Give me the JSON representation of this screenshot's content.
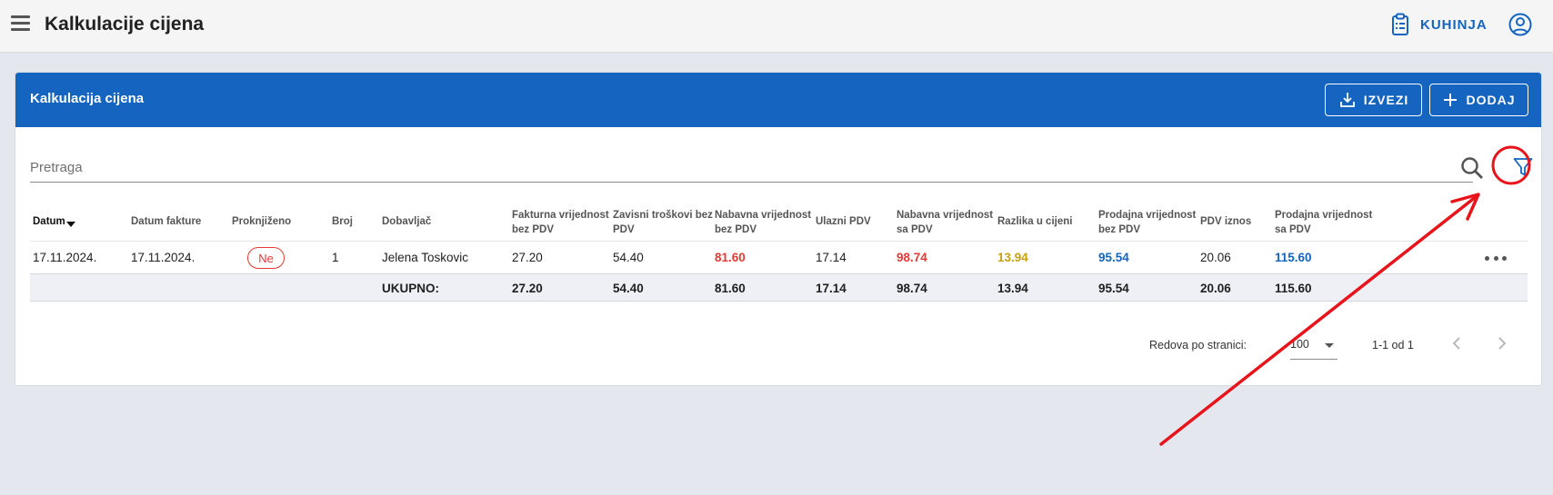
{
  "app": {
    "title": "Kalkulacije cijena",
    "kitchen_label": "KUHINJA"
  },
  "card": {
    "title": "Kalkulacija cijena",
    "export_label": "IZVEZI",
    "add_label": "DODAJ"
  },
  "search": {
    "placeholder": "Pretraga"
  },
  "table": {
    "headers": {
      "datum": "Datum",
      "datum_fakture": "Datum fakture",
      "proknjizeno": "Proknjiženo",
      "broj": "Broj",
      "dobavljac": "Dobavljač",
      "fakturna_1": "Fakturna vrijednost",
      "fakturna_2": "bez PDV",
      "zavisni_1": "Zavisni troškovi bez",
      "zavisni_2": "PDV",
      "nabavna_bez_1": "Nabavna vrijednost",
      "nabavna_bez_2": "bez PDV",
      "ulazni_pdv": "Ulazni PDV",
      "nabavna_sa_1": "Nabavna vrijednost",
      "nabavna_sa_2": "sa PDV",
      "razlika": "Razlika u cijeni",
      "prodajna_bez_1": "Prodajna vrijednost",
      "prodajna_bez_2": "bez PDV",
      "pdv_iznos": "PDV iznos",
      "prodajna_sa_1": "Prodajna vrijednost",
      "prodajna_sa_2": "sa PDV"
    },
    "rows": [
      {
        "datum": "17.11.2024.",
        "datum_fakture": "17.11.2024.",
        "proknjizeno": "Ne",
        "broj": "1",
        "dobavljac": "Jelena Toskovic",
        "fakturna": "27.20",
        "zavisni": "54.40",
        "nabavna_bez": "81.60",
        "ulazni_pdv": "17.14",
        "nabavna_sa": "98.74",
        "razlika": "13.94",
        "prodajna_bez": "95.54",
        "pdv_iznos": "20.06",
        "prodajna_sa": "115.60"
      }
    ],
    "totals": {
      "label": "UKUPNO:",
      "fakturna": "27.20",
      "zavisni": "54.40",
      "nabavna_bez": "81.60",
      "ulazni_pdv": "17.14",
      "nabavna_sa": "98.74",
      "razlika": "13.94",
      "prodajna_bez": "95.54",
      "pdv_iznos": "20.06",
      "prodajna_sa": "115.60"
    }
  },
  "pagination": {
    "rows_per_page_label": "Redova po stranici:",
    "rows_per_page": "100",
    "range": "1-1 od 1"
  },
  "colors": {
    "primary": "#1565c0",
    "negative": "#e53935",
    "difference": "#c9a10e",
    "annotation": "#e8141b"
  },
  "icons": [
    "menu-icon",
    "clipboard-icon",
    "account-circle-icon",
    "download-icon",
    "plus-icon",
    "search-icon",
    "filter-icon",
    "more-horiz-icon",
    "chevron-left-icon",
    "chevron-right-icon",
    "sort-desc-icon"
  ]
}
